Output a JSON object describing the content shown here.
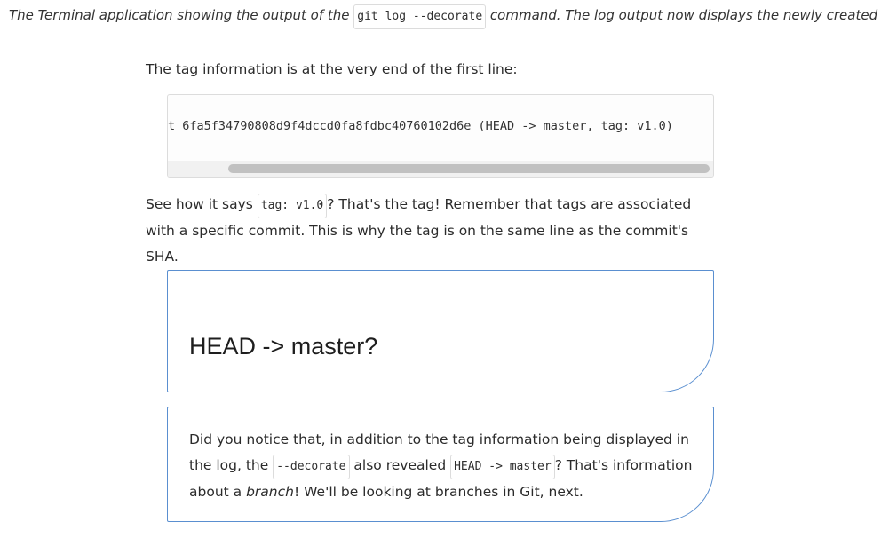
{
  "caption": {
    "before": "The Terminal application showing the output of the ",
    "code": "git log --decorate",
    "after": " command. The log output now displays the newly created tag."
  },
  "intro": {
    "text": "The tag information is at the very end of the first line:"
  },
  "code_block": {
    "line": "t 6fa5f34790808d9f4dccd0fa8fdbc40760102d6e (HEAD -> master, tag: v1.0)"
  },
  "explanation": {
    "before": "See how it says ",
    "code": "tag: v1.0",
    "after": "? That's the tag! Remember that tags are associated with a specific commit. This is why the tag is on the same line as the commit's SHA."
  },
  "callout_heading": {
    "title": "HEAD -> master?"
  },
  "callout_note": {
    "part1": "Did you notice that, in addition to the tag information being displayed in the log, the ",
    "code1": "--decorate",
    "part2": " also revealed ",
    "code2": "HEAD -> master",
    "part3": "? That's information about a ",
    "emphasis": "branch",
    "part4": "! We'll be looking at branches in Git, next."
  },
  "colors": {
    "callout_border": "#5a8fd0",
    "scroll_thumb": "#c1c1c1"
  }
}
